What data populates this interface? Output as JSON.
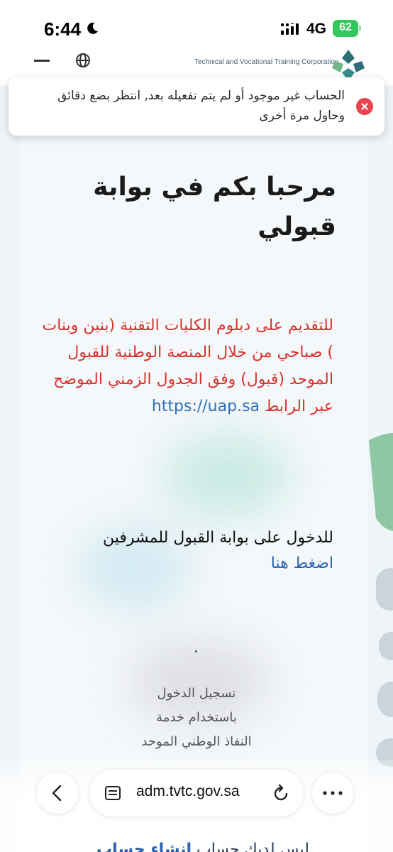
{
  "status_bar": {
    "time": "6:44",
    "network": "4G",
    "battery": "62"
  },
  "header": {
    "org_name": "Technical and Vocational Training Corporation"
  },
  "toast": {
    "message": "الحساب غير موجود أو لم يتم تفعيله بعد, انتظر بضع دقائق وحاول مرة أخرى"
  },
  "main": {
    "welcome_title": "مرحبا بكم في بوابة قبولي",
    "apply_text": "للتقديم  على دبلوم الكليات التقنية (بنين وبنات ) صباحي من خلال المنصة الوطنية للقبول الموحد (قبول) وفق الجدول الزمني الموضح عبر الرابط",
    "apply_link": "https://uap.sa",
    "supervisors_text": "للدخول على بوابة القبول للمشرفين",
    "supervisors_link": "اضغط هنا",
    "login_line1": "تسجيل الدخول",
    "login_line2": "باستخدام خدمة",
    "login_line3": "النفاذ الوطني الموحد",
    "register_text": "ليس لديك حساب",
    "register_link": "انشاء حساب"
  },
  "browser": {
    "url": "adm.tvtc.gov.sa"
  },
  "colors": {
    "accent_red": "#d8312b",
    "link_blue": "#2b62b2",
    "battery_green": "#34c759",
    "close_red": "#e8434f"
  }
}
